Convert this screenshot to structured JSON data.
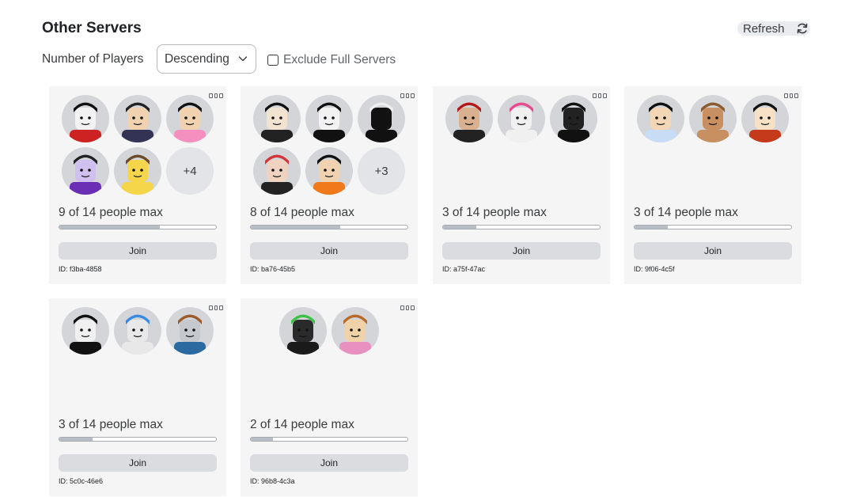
{
  "header": {
    "title": "Other Servers",
    "refresh_label": "Refresh"
  },
  "filters": {
    "sort_label": "Number of Players",
    "sort_value": "Descending",
    "exclude_label": "Exclude Full Servers",
    "exclude_checked": false
  },
  "colors": {
    "card_bg": "#f5f5f5",
    "bar_fill": "#b8bcc6",
    "join_bg": "#dadce0"
  },
  "servers": [
    {
      "players": 9,
      "max": 14,
      "count_text": "9 of 14 people max",
      "fill_fraction": 0.643,
      "join_label": "Join",
      "id_text": "ID: f3ba-4858",
      "extra_text": "+4",
      "avatars": [
        "avatar-hollow-knight",
        "avatar-pirate-hat",
        "avatar-pink-bow",
        "avatar-purple-hair",
        "avatar-noob-smile"
      ]
    },
    {
      "players": 8,
      "max": 14,
      "count_text": "8 of 14 people max",
      "fill_fraction": 0.571,
      "join_label": "Join",
      "id_text": "ID: ba76-45b5",
      "extra_text": "+3",
      "avatars": [
        "avatar-black-hair",
        "avatar-white-mask",
        "avatar-black-hat",
        "avatar-red-hair",
        "avatar-fire-outfit"
      ]
    },
    {
      "players": 3,
      "max": 14,
      "count_text": "3 of 14 people max",
      "fill_fraction": 0.214,
      "join_label": "Join",
      "id_text": "ID: a75f-47ac",
      "extra_text": "",
      "avatars": [
        "avatar-red-armor",
        "avatar-pink-glasses",
        "avatar-black-suit"
      ]
    },
    {
      "players": 3,
      "max": 14,
      "count_text": "3 of 14 people max",
      "fill_fraction": 0.214,
      "join_label": "Join",
      "id_text": "ID: 9f06-4c5f",
      "extra_text": "",
      "avatars": [
        "avatar-sailor-cap",
        "avatar-mouse-face",
        "avatar-red-beanie"
      ]
    },
    {
      "players": 3,
      "max": 14,
      "count_text": "3 of 14 people max",
      "fill_fraction": 0.214,
      "join_label": "Join",
      "id_text": "ID: 5c0c-46e6",
      "extra_text": "",
      "avatars": [
        "avatar-black-beret",
        "avatar-blue-shark",
        "avatar-sunglasses"
      ]
    },
    {
      "players": 2,
      "max": 14,
      "count_text": "2 of 14 people max",
      "fill_fraction": 0.143,
      "join_label": "Join",
      "id_text": "ID: 96b8-4c3a",
      "extra_text": "",
      "avatars": [
        "avatar-green-alien",
        "avatar-brown-hair"
      ]
    }
  ]
}
